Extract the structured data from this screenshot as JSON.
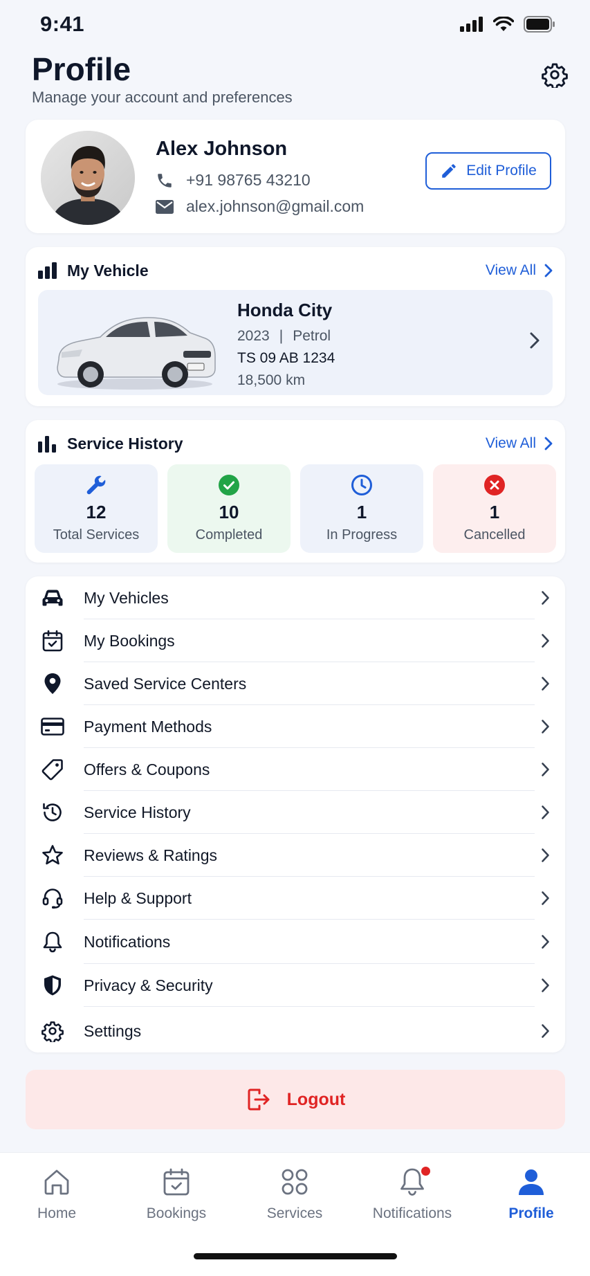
{
  "status_bar": {
    "time": "9:41"
  },
  "header": {
    "title": "Profile",
    "subtitle": "Manage your account and preferences"
  },
  "profile": {
    "name": "Alex Johnson",
    "phone": "+91 98765 43210",
    "email": "alex.johnson@gmail.com",
    "edit_label": "Edit Profile"
  },
  "vehicle": {
    "section_title": "My Vehicle",
    "view_all": "View All",
    "name": "Honda City",
    "year": "2023",
    "separator": "|",
    "fuel": "Petrol",
    "plate": "TS 09 AB 1234",
    "odometer": "18,500 km"
  },
  "service_history": {
    "section_title": "Service History",
    "view_all": "View All",
    "stats": [
      {
        "value": "12",
        "label": "Total Services",
        "icon": "wrench-icon",
        "bg": "#eef2fa",
        "color": "#1f5ed8"
      },
      {
        "value": "10",
        "label": "Completed",
        "icon": "check-circle-icon",
        "bg": "#ecf8ef",
        "color": "#22a447"
      },
      {
        "value": "1",
        "label": "In Progress",
        "icon": "clock-icon",
        "bg": "#eef2fa",
        "color": "#1f5ed8"
      },
      {
        "value": "1",
        "label": "Cancelled",
        "icon": "x-circle-icon",
        "bg": "#fdeeee",
        "color": "#e02424"
      }
    ]
  },
  "menu": {
    "items": [
      {
        "label": "My Vehicles",
        "icon": "car-icon"
      },
      {
        "label": "My Bookings",
        "icon": "calendar-check-icon"
      },
      {
        "label": "Saved Service Centers",
        "icon": "location-pin-icon"
      },
      {
        "label": "Payment Methods",
        "icon": "credit-card-icon"
      },
      {
        "label": "Offers & Coupons",
        "icon": "tag-icon"
      },
      {
        "label": "Service History",
        "icon": "history-icon"
      },
      {
        "label": "Reviews & Ratings",
        "icon": "star-icon"
      },
      {
        "label": "Help & Support",
        "icon": "headset-icon"
      },
      {
        "label": "Notifications",
        "icon": "bell-icon"
      },
      {
        "label": "Privacy & Security",
        "icon": "shield-icon"
      },
      {
        "label": "Settings",
        "icon": "gear-icon"
      }
    ]
  },
  "logout": {
    "label": "Logout"
  },
  "tabs": [
    {
      "label": "Home",
      "icon": "home-icon",
      "active": false
    },
    {
      "label": "Bookings",
      "icon": "calendar-icon",
      "active": false
    },
    {
      "label": "Services",
      "icon": "grid-icon",
      "active": false
    },
    {
      "label": "Notifications",
      "icon": "bell-icon",
      "active": false,
      "badge": true
    },
    {
      "label": "Profile",
      "icon": "user-icon",
      "active": true
    }
  ],
  "colors": {
    "accent": "#1f5ed8",
    "danger": "#e02424",
    "success": "#22a447"
  }
}
